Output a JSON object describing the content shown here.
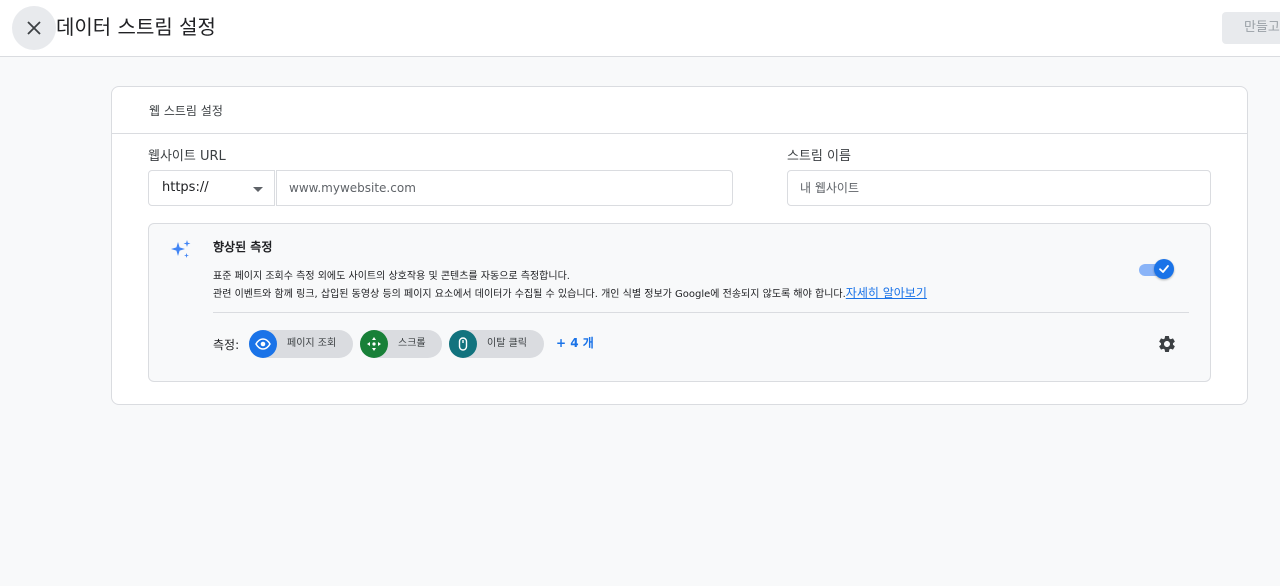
{
  "header": {
    "title": "데이터 스트림 설정",
    "create_label": "만들고"
  },
  "card": {
    "title": "웹 스트림 설정",
    "website_url_label": "웹사이트 URL",
    "protocol_value": "https://",
    "url_placeholder": "www.mywebsite.com",
    "stream_name_label": "스트림 이름",
    "stream_name_placeholder": "내 웹사이트"
  },
  "enhanced": {
    "title": "향상된 측정",
    "description_line1": "표준 페이지 조회수 측정 외에도 사이트의 상호작용 및 콘텐츠를 자동으로 측정합니다.",
    "description_line2": "관련 이벤트와 함께 링크, 삽입된 동영상 등의 페이지 요소에서 데이터가 수집될 수 있습니다. 개인 식별 정보가 Google에 전송되지 않도록 해야 합니다.",
    "learn_more": "자세히 알아보기",
    "toggle_on": true,
    "measurements_label": "측정:",
    "chips": [
      {
        "label": "페이지 조회",
        "icon": "eye-icon",
        "color": "#1a73e8"
      },
      {
        "label": "스크롤",
        "icon": "scroll-crosshair-icon",
        "color": "#188038"
      },
      {
        "label": "이탈 클릭",
        "icon": "mouse-icon",
        "color": "#12737e"
      }
    ],
    "more_label": "+ 4 개"
  },
  "colors": {
    "accent": "#1a73e8",
    "toggle_track": "#8ab4f8",
    "border": "#dadce0"
  }
}
